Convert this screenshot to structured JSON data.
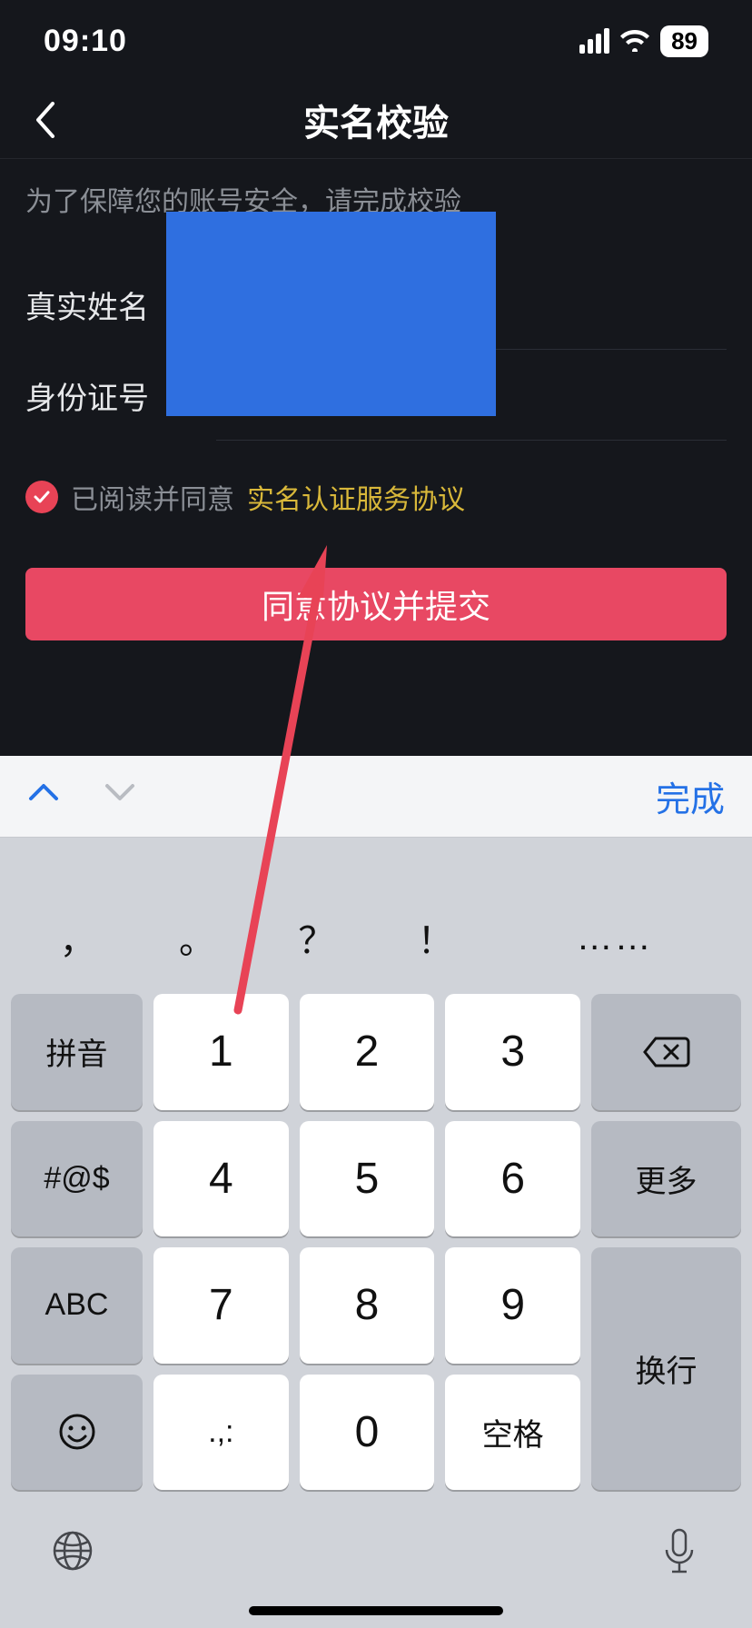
{
  "status": {
    "time": "09:10",
    "battery": "89"
  },
  "nav": {
    "title": "实名校验"
  },
  "form": {
    "hint": "为了保障您的账号安全，请完成校验",
    "name_label": "真实姓名",
    "id_label": "身份证号"
  },
  "agreement": {
    "prefix": "已阅读并同意",
    "link": "实名认证服务协议"
  },
  "submit": {
    "label": "同意协议并提交"
  },
  "keyboard": {
    "done": "完成",
    "punct": {
      "comma": "，",
      "period": "。",
      "question": "？",
      "exclaim": "！",
      "ellipsis": "……"
    },
    "rows": {
      "r1": {
        "side_left": "拼音",
        "k1": "1",
        "k2": "2",
        "k3": "3"
      },
      "r2": {
        "side_left": "#@$",
        "k1": "4",
        "k2": "5",
        "k3": "6",
        "side_right": "更多"
      },
      "r3": {
        "side_left": "ABC",
        "k1": "7",
        "k2": "8",
        "k3": "9"
      },
      "r4": {
        "k1": ".,:",
        "k2": "0",
        "k3": "空格",
        "side_right": "换行"
      }
    }
  }
}
